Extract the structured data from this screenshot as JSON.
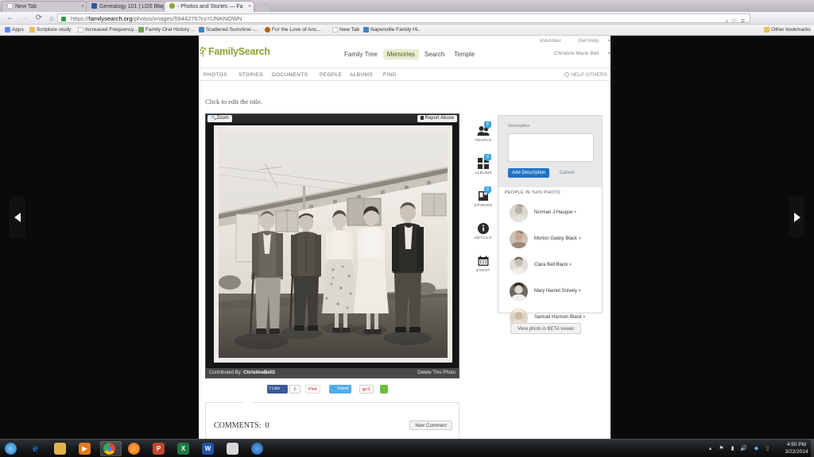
{
  "browser": {
    "tabs": [
      {
        "title": "New Tab",
        "favicon_color": "#ffffff",
        "active": false
      },
      {
        "title": "Genealogy 101 | LDS Blog",
        "favicon_color": "#2c5aa0",
        "active": false
      },
      {
        "title": "- Photos and Stories — Fa",
        "favicon_color": "#8aa432",
        "active": true
      }
    ],
    "nav": {
      "back_icon": "back-arrow-icon",
      "forward_icon": "forward-arrow-icon",
      "reload_icon": "reload-icon",
      "home_icon": "home-icon"
    },
    "address": {
      "lock_icon": "lock-icon",
      "scheme": "https://",
      "domain": "familysearch.org",
      "path": "/photos/images/5944276?cc=UNKNOWN",
      "full_url": "https://familysearch.org/photos/images/5944276?cc=UNKNOWN",
      "search_icon": "magnifier-icon",
      "star_icon": "star-icon",
      "menu_icon": "hamburger-menu-icon"
    },
    "bookmarks": [
      {
        "label": "Apps",
        "icon_color": "#5b8def"
      },
      {
        "label": "Scripture study",
        "icon_color": "#e8c05a"
      },
      {
        "label": "Increased Frequency...",
        "icon_color": "#ffffff"
      },
      {
        "label": "Family Oral History ...",
        "icon_color": "#6aa84f"
      },
      {
        "label": "Scattered Sunshine -...",
        "icon_color": "#3d85c6"
      },
      {
        "label": "For the Love of Anc...",
        "icon_color": "#b45f06"
      },
      {
        "label": "New Tab",
        "icon_color": "#ffffff"
      },
      {
        "label": "Napenville Family Hi..",
        "icon_color": "#3d85c6"
      }
    ],
    "other_bookmarks": "Other bookmarks"
  },
  "site": {
    "logo_text": "FamilySearch",
    "nav": [
      {
        "label": "Family Tree",
        "selected": false
      },
      {
        "label": "Memories",
        "selected": true
      },
      {
        "label": "Search",
        "selected": false
      },
      {
        "label": "Temple",
        "selected": false
      }
    ],
    "utility": {
      "volunteer": "Volunteer",
      "get_help": "Get Help",
      "user": "Christine Marie Bell"
    },
    "subnav": [
      {
        "label": "PHOTOS"
      },
      {
        "label": "STORIES"
      },
      {
        "label": "DOCUMENTS"
      },
      {
        "label": "PEOPLE"
      },
      {
        "label": "ALBUMS"
      },
      {
        "label": "FIND"
      }
    ],
    "help_others": "HELP OTHERS"
  },
  "photo": {
    "title_placeholder": "Click to edit the title.",
    "zoom_label": "Zoom",
    "report_abuse": "Report Abuse",
    "contributed_prefix": "Contributed By:",
    "contributor": "ChristineBell1",
    "delete_label": "Delete This Photo"
  },
  "social": {
    "facebook_like": "Like",
    "facebook_count": "0",
    "pinterest": "Pinit",
    "twitter": "Tweet",
    "google_plus": "+1",
    "other_share": "share-icon"
  },
  "comments": {
    "heading": "COMMENTS:",
    "count": "0",
    "new_comment": "New Comment"
  },
  "rail": [
    {
      "label": "PEOPLE",
      "badge": "5",
      "icon": "people-icon"
    },
    {
      "label": "ALBUMS",
      "badge": "0",
      "icon": "albums-grid-icon"
    },
    {
      "label": "STORIES",
      "badge": "0",
      "icon": "book-icon"
    },
    {
      "label": "DETAILS",
      "badge": null,
      "icon": "info-icon"
    },
    {
      "label": "EVENT",
      "badge": null,
      "icon": "calendar-icon"
    }
  ],
  "panel": {
    "description_label": "Description",
    "description_value": "",
    "add_description": "Add Description",
    "cancel": "Cancel",
    "people_heading": "PEOPLE IN THIS PHOTO",
    "people": [
      {
        "name": "Norman J Haugse"
      },
      {
        "name": "Morton Gately Black"
      },
      {
        "name": "Clara Bell Black"
      },
      {
        "name": "Mary Harriet Snively"
      },
      {
        "name": "Samuel Harmon Black"
      }
    ],
    "beta_viewer": "View photo in BETA viewer"
  },
  "nav_arrows": {
    "prev": "previous-photo-arrow",
    "next": "next-photo-arrow"
  },
  "taskbar": {
    "apps": [
      {
        "name": "start-button",
        "glyph": "",
        "color": "#1f7ac4",
        "active": false
      },
      {
        "name": "internet-explorer",
        "glyph": "e",
        "color": "#1a6fc4",
        "active": false
      },
      {
        "name": "file-explorer",
        "glyph": "",
        "color": "#e0b44a",
        "active": false
      },
      {
        "name": "media-player",
        "glyph": "▶",
        "color": "#e07b1e",
        "active": false
      },
      {
        "name": "google-chrome",
        "glyph": "",
        "color": "#4a8df0",
        "active": true
      },
      {
        "name": "mozilla-firefox",
        "glyph": "",
        "color": "#e2621b",
        "active": false
      },
      {
        "name": "powerpoint",
        "glyph": "P",
        "color": "#c2472b",
        "active": false
      },
      {
        "name": "excel",
        "glyph": "X",
        "color": "#1f7a44",
        "active": false
      },
      {
        "name": "word",
        "glyph": "W",
        "color": "#2052a8",
        "active": false
      },
      {
        "name": "calculator",
        "glyph": "",
        "color": "#d9d9d9",
        "active": false
      },
      {
        "name": "dell-support",
        "glyph": "",
        "color": "#2878c4",
        "active": false
      }
    ],
    "tray_icons": [
      "show-hidden-icons",
      "network-icon",
      "signal-icon",
      "volume-icon",
      "security-icon",
      "battery-icon"
    ],
    "time": "4:50 PM",
    "date": "3/22/2014"
  },
  "colors": {
    "brand_green": "#8aa432",
    "accent_blue": "#1f73c4",
    "badge_blue": "#3aa8d8",
    "memories_bg": "#e7edd0"
  }
}
